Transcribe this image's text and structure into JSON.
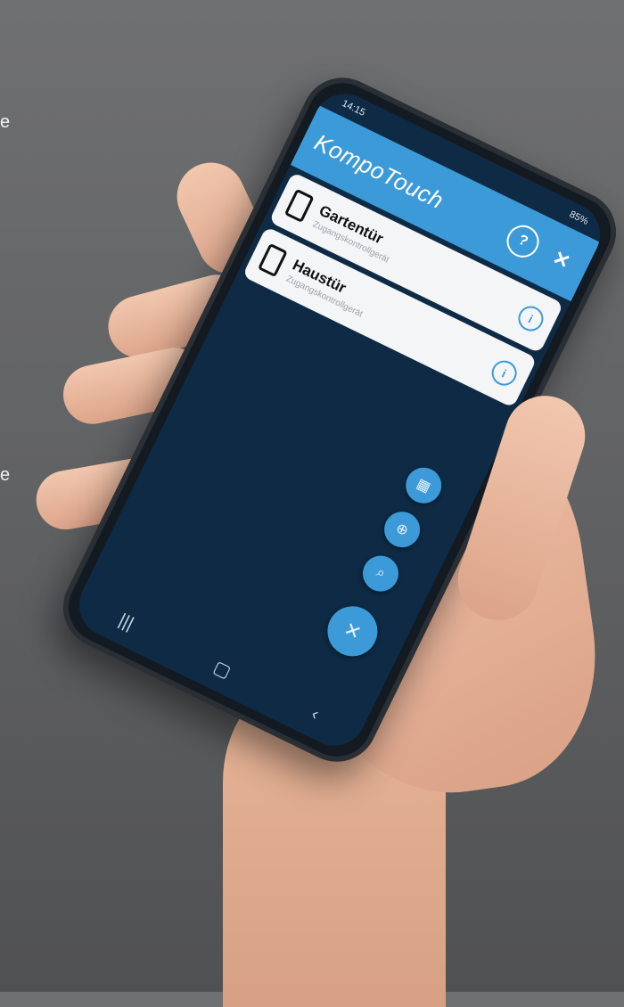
{
  "page": {
    "left_fragments": [
      "e",
      "e"
    ]
  },
  "status_bar": {
    "time": "14:15",
    "battery": "85%"
  },
  "app_bar": {
    "title": "KompoTouch",
    "help_icon": "help-circle-icon",
    "close_icon": "close-icon",
    "help_glyph": "?",
    "close_glyph": "✕"
  },
  "devices": [
    {
      "name": "Gartentür",
      "subtitle": "Zugangskontrollgerät",
      "info_glyph": "i"
    },
    {
      "name": "Haustür",
      "subtitle": "Zugangskontrollgerät",
      "info_glyph": "i"
    }
  ],
  "fabs": {
    "fab1_glyph": "▦",
    "fab2_glyph": "⊕",
    "fab3_glyph": "⌕",
    "main_glyph": "✕"
  },
  "nav_bar": {
    "recent_glyph": "|||",
    "home_glyph": "▢",
    "back_glyph": "‹"
  },
  "colors": {
    "accent": "#3d9ad8",
    "screen_bg": "#0e2a44",
    "card_bg": "#f3f5f7"
  }
}
